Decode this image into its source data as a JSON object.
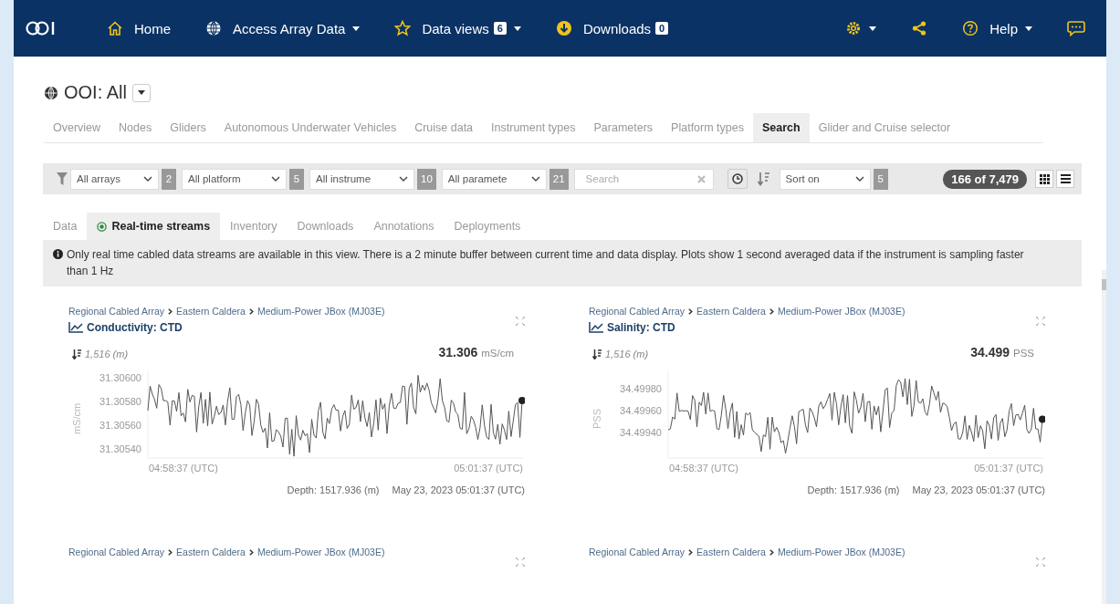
{
  "nav": {
    "items": [
      {
        "label": "Home",
        "caret": false
      },
      {
        "label": "Access Array Data",
        "caret": true
      },
      {
        "label": "Data views",
        "badge": "6",
        "caret": true
      },
      {
        "label": "Downloads",
        "badge": "0",
        "caret": false
      }
    ],
    "right": [
      {
        "caret": true
      },
      {
        "caret": false
      },
      {
        "label": "Help",
        "caret": true
      },
      {
        "caret": false
      }
    ]
  },
  "header": {
    "title": "OOI: All"
  },
  "tabs": [
    {
      "label": "Overview",
      "selected": false
    },
    {
      "label": "Nodes",
      "selected": false
    },
    {
      "label": "Gliders",
      "selected": false
    },
    {
      "label": "Autonomous Underwater Vehicles",
      "selected": false
    },
    {
      "label": "Cruise data",
      "selected": false
    },
    {
      "label": "Instrument types",
      "selected": false
    },
    {
      "label": "Parameters",
      "selected": false
    },
    {
      "label": "Platform types",
      "selected": false
    },
    {
      "label": "Search",
      "selected": true
    },
    {
      "label": "Glider and Cruise selector",
      "selected": false
    }
  ],
  "filters": {
    "selects": [
      {
        "value": "All arrays",
        "count": "2"
      },
      {
        "value": "All platform",
        "count": "5"
      },
      {
        "value": "All instrume",
        "count": "10"
      },
      {
        "value": "All paramete",
        "count": "21"
      }
    ],
    "search": {
      "placeholder": "Search"
    },
    "sort": {
      "value": "Sort on",
      "count": "5"
    },
    "result_count": "166 of 7,479"
  },
  "subtabs": [
    {
      "label": "Data",
      "selected": false
    },
    {
      "label": "Real-time streams",
      "selected": true
    },
    {
      "label": "Inventory",
      "selected": false
    },
    {
      "label": "Downloads",
      "selected": false
    },
    {
      "label": "Annotations",
      "selected": false
    },
    {
      "label": "Deployments",
      "selected": false
    }
  ],
  "info": "Only real time cabled data streams are available in this view. There is a 2 minute buffer between current time and data display. Plots show 1 second averaged data if the instrument is sampling faster than 1 Hz",
  "cards": [
    {
      "breadcrumb": [
        "Regional Cabled Array",
        "Eastern Caldera",
        "Medium-Power JBox (MJ03E)"
      ],
      "title": "Conductivity: CTD",
      "depth": "1,516 (m)",
      "value": "31.306",
      "unit": "mS/cm",
      "chart": {
        "y_label": "mS/cm",
        "y_ticks": [
          "31.30600",
          "31.30580",
          "31.30560",
          "31.30540"
        ],
        "x_ticks": [
          "04:58:37 (UTC)",
          "05:01:37 (UTC)"
        ]
      },
      "footer_depth": "Depth: 1517.936 (m)",
      "footer_time": "May 23, 2023 05:01:37 (UTC)"
    },
    {
      "breadcrumb": [
        "Regional Cabled Array",
        "Eastern Caldera",
        "Medium-Power JBox (MJ03E)"
      ],
      "title": "Salinity: CTD",
      "depth": "1,516 (m)",
      "value": "34.499",
      "unit": "PSS",
      "chart": {
        "y_label": "PSS",
        "y_ticks": [
          "34.49980",
          "34.49960",
          "34.49940"
        ],
        "x_ticks": [
          "04:58:37 (UTC)",
          "05:01:37 (UTC)"
        ]
      },
      "footer_depth": "Depth: 1517.936 (m)",
      "footer_time": "May 23, 2023 05:01:37 (UTC)"
    },
    {
      "breadcrumb": [
        "Regional Cabled Array",
        "Eastern Caldera",
        "Medium-Power JBox (MJ03E)"
      ]
    },
    {
      "breadcrumb": [
        "Regional Cabled Array",
        "Eastern Caldera",
        "Medium-Power JBox (MJ03E)"
      ]
    }
  ]
}
